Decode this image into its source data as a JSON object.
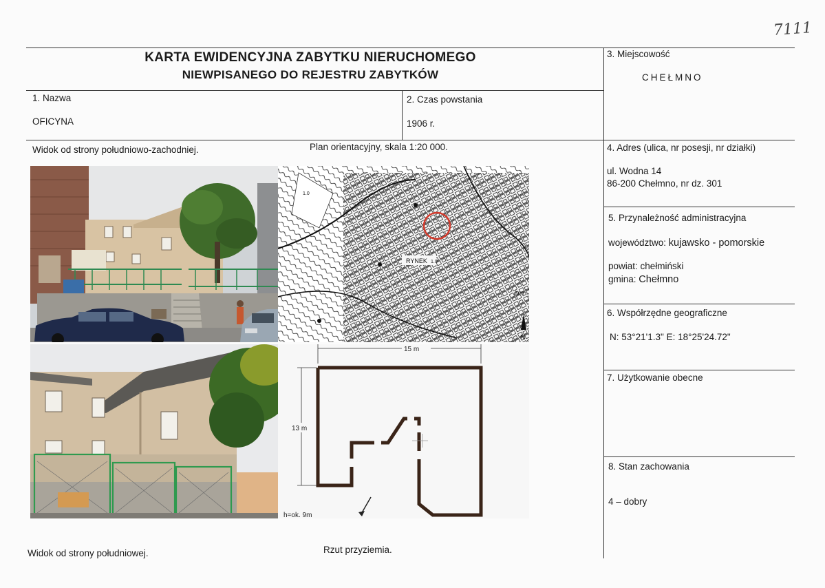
{
  "handwritten_number": "7111",
  "title": {
    "line1": "KARTA EWIDENCYJNA ZABYTKU NIERUCHOMEGO",
    "line2": "NIEWPISANEGO DO REJESTRU ZABYTKÓW"
  },
  "fields": {
    "nazwa": {
      "label": "1. Nazwa",
      "value": "OFICYNA"
    },
    "czas": {
      "label": "2. Czas powstania",
      "value": "1906 r."
    },
    "miejscowosc": {
      "label": "3. Miejscowość",
      "value": "CHEŁMNO"
    },
    "adres": {
      "label": "4. Adres (ulica, nr posesji, nr działki)",
      "line1": "ul.  Wodna 14",
      "line2": "86-200 Chełmno, nr dz. 301"
    },
    "przynaleznosc": {
      "label": "5. Przynależność administracyjna",
      "woj_prefix": "województwo: ",
      "woj_value": "kujawsko - pomorskie",
      "powiat": "powiat: chełmiński",
      "gmina_prefix": "gmina: ",
      "gmina_value": "Chełmno"
    },
    "wspolrzedne": {
      "label": "6. Współrzędne geograficzne",
      "value": "N: 53°21'1.3\" E: 18°25'24.72\""
    },
    "uzytkowanie": {
      "label": "7. Użytkowanie obecne",
      "value": ""
    },
    "stan": {
      "label": "8. Stan zachowania",
      "value": "4 – dobry"
    }
  },
  "captions": {
    "view_sw": "Widok od strony południowo-zachodniej.",
    "plan": "Plan orientacyjny, skala 1:20 000.",
    "view_s": "Widok od strony południowej.",
    "floor_plan": "Rzut przyziemia."
  },
  "map": {
    "label_rynek": "RYNEK",
    "label_arm": "Arm",
    "north": "N",
    "elev1": "1.0",
    "elev2": "1.0"
  },
  "floor_plan": {
    "width_label": "15 m",
    "height_label": "13 m",
    "h_label": "h=ok. 9m"
  },
  "colors": {
    "marker": "#d33a2c",
    "wall": "#3a2418"
  }
}
